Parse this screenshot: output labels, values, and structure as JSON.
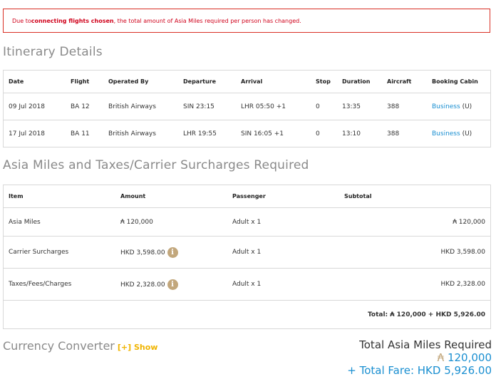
{
  "alert": {
    "prefix": "Due to ",
    "bold": "connecting flights chosen",
    "suffix": ", the total amount of Asia Miles required per person has changed."
  },
  "itinerary": {
    "title": "Itinerary Details",
    "headers": [
      "Date",
      "Flight",
      "Operated By",
      "Departure",
      "Arrival",
      "Stop",
      "Duration",
      "Aircraft",
      "Booking Cabin"
    ],
    "rows": [
      {
        "date": "09 Jul 2018",
        "flight": "BA 12",
        "operated": "British Airways",
        "departure": "SIN 23:15",
        "arrival": "LHR 05:50 +1",
        "stop": "0",
        "duration": "13:35",
        "aircraft": "388",
        "cabin": "Business",
        "cabin_code": "(U)"
      },
      {
        "date": "17 Jul 2018",
        "flight": "BA 11",
        "operated": "British Airways",
        "departure": "LHR 19:55",
        "arrival": "SIN 16:05 +1",
        "stop": "0",
        "duration": "13:10",
        "aircraft": "388",
        "cabin": "Business",
        "cabin_code": "(U)"
      }
    ]
  },
  "miles": {
    "title": "Asia Miles and Taxes/Carrier Surcharges Required",
    "headers": [
      "Item",
      "Amount",
      "Passenger",
      "Subtotal"
    ],
    "rows": [
      {
        "item": "Asia Miles",
        "amount": "₳ 120,000",
        "passenger": "Adult x 1",
        "subtotal": "₳ 120,000"
      },
      {
        "item": "Carrier Surcharges",
        "amount": "HKD 3,598.00",
        "passenger": "Adult x 1",
        "subtotal": "HKD 3,598.00"
      },
      {
        "item": "Taxes/Fees/Charges",
        "amount": "HKD 2,328.00",
        "passenger": "Adult x 1",
        "subtotal": "HKD 2,328.00"
      }
    ],
    "total": "Total: ₳ 120,000 + HKD 5,926.00",
    "info_glyph": "i"
  },
  "currency": {
    "title": "Currency Converter",
    "toggle": "[+] Show"
  },
  "summary": {
    "title": "Total Asia Miles Required",
    "miles_symbol": "₳",
    "miles": "120,000",
    "fare": "+ Total Fare: HKD 5,926.00"
  }
}
